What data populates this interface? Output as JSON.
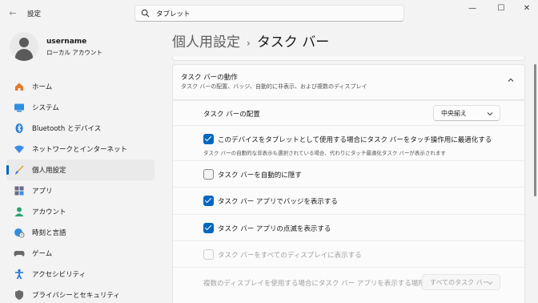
{
  "app": {
    "title": "設定"
  },
  "search": {
    "value": "タブレット"
  },
  "window": {
    "minimize": "—",
    "maximize": "☐",
    "close": "✕"
  },
  "user": {
    "name": "username",
    "type": "ローカル アカウント"
  },
  "nav": [
    {
      "label": "ホーム",
      "icon": "home-icon"
    },
    {
      "label": "システム",
      "icon": "system-icon"
    },
    {
      "label": "Bluetooth とデバイス",
      "icon": "bluetooth-icon"
    },
    {
      "label": "ネットワークとインターネット",
      "icon": "network-icon"
    },
    {
      "label": "個人用設定",
      "icon": "brush-icon",
      "active": true
    },
    {
      "label": "アプリ",
      "icon": "apps-icon"
    },
    {
      "label": "アカウント",
      "icon": "account-icon"
    },
    {
      "label": "時刻と言語",
      "icon": "globe-clock-icon"
    },
    {
      "label": "ゲーム",
      "icon": "gamepad-icon"
    },
    {
      "label": "アクセシビリティ",
      "icon": "accessibility-icon"
    },
    {
      "label": "プライバシーとセキュリティ",
      "icon": "shield-icon"
    }
  ],
  "breadcrumb": {
    "parent": "個人用設定",
    "separator": "›",
    "current": "タスク バー"
  },
  "section": {
    "title": "タスク バーの動作",
    "subtitle": "タスク バーの配置、バッジ、自動的に非表示、および複数のディスプレイ"
  },
  "settings": {
    "alignment": {
      "label": "タスク バーの配置",
      "value": "中央揃え"
    },
    "tablet_optimize": {
      "label": "このデバイスをタブレットとして使用する場合にタスク バーをタッチ操作用に最適化する",
      "description": "タスク バーの自動的な非表示も選択されている場合、代わりにタッチ最適化タスク バーが表示されます",
      "checked": true
    },
    "auto_hide": {
      "label": "タスク バーを自動的に隠す",
      "checked": false
    },
    "badges": {
      "label": "タスク バー アプリでバッジを表示する",
      "checked": true
    },
    "flashing": {
      "label": "タスク バー アプリの点滅を表示する",
      "checked": true
    },
    "all_displays": {
      "label": "タスク バーをすべてのディスプレイに表示する",
      "checked": false,
      "disabled": true
    },
    "multi_display": {
      "label": "複数のディスプレイを使用する場合にタスク バー アプリを表示する場所",
      "value": "すべてのタスク バー",
      "disabled": true
    }
  },
  "colors": {
    "accent": "#0067c0",
    "background": "#f3f3f3",
    "card": "#fbfbfb"
  }
}
